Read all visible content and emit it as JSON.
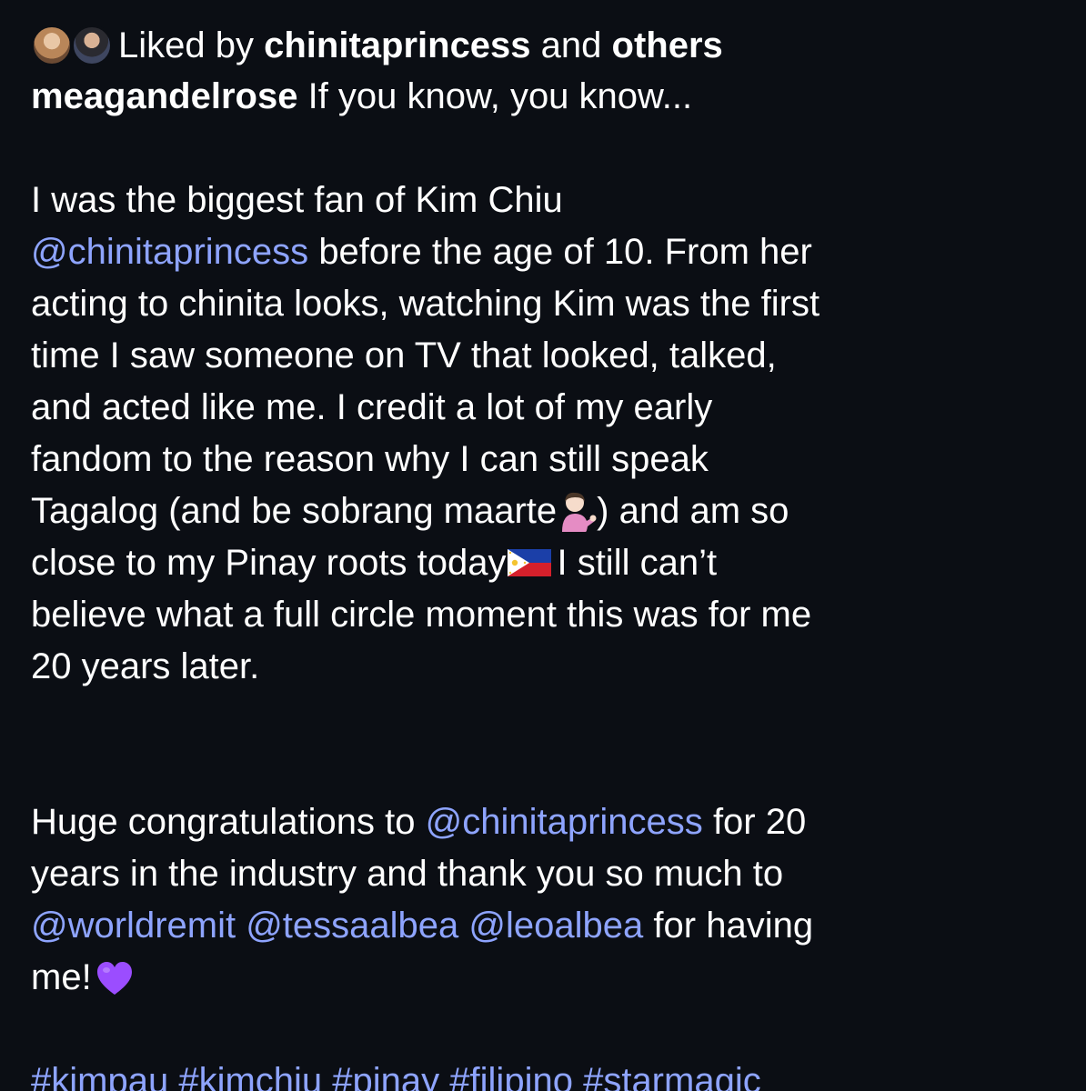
{
  "liked": {
    "prefix": "Liked by",
    "user": "chinitaprincess",
    "and": "and",
    "others": "others"
  },
  "caption": {
    "author": "meagandelrose",
    "first_line": "If you know, you know...",
    "p1_l1": "I was the biggest fan of Kim Chiu",
    "p1_l2_mention": "@chinitaprincess",
    "p1_l2_rest": "before the age of 10. From her",
    "p1_l3": "acting to chinita looks, watching Kim was the first",
    "p1_l4": "time I saw someone on TV that looked, talked,",
    "p1_l5": "and acted like me. I credit a lot of my early",
    "p1_l6": "fandom to the reason why I can still speak",
    "p1_l7_a": "Tagalog (and be sobrang maarte",
    "p1_l7_b": ") and am so",
    "p1_l8_a": "close to my Pinay roots today",
    "p1_l8_b": "I still can’t",
    "p1_l9": "believe what a full circle moment this was for me",
    "p1_l10": "20 years later.",
    "p2_l1_a": "Huge congratulations to",
    "p2_l1_mention": "@chinitaprincess",
    "p2_l1_b": "for 20",
    "p2_l2": "years in the industry and thank you so much to",
    "p2_l3_m1": "@worldremit",
    "p2_l3_m2": "@tessaalbea",
    "p2_l3_m3": "@leoalbea",
    "p2_l3_b": "for having",
    "p2_l4": "me!",
    "hashtags": [
      "#kimpau",
      "#kimchiu",
      "#pinay",
      "#filipino",
      "#starmagic"
    ]
  },
  "icons": {
    "avatar_1": "avatar-woman",
    "avatar_2": "avatar-man",
    "emoji_1": "tipping-hand-woman-emoji",
    "emoji_2": "philippines-flag-emoji",
    "emoji_3": "purple-heart-emoji"
  },
  "colors": {
    "background": "#0b0e14",
    "text": "#ffffff",
    "mention": "#8ea4ff",
    "heart": "#9b4dff"
  }
}
